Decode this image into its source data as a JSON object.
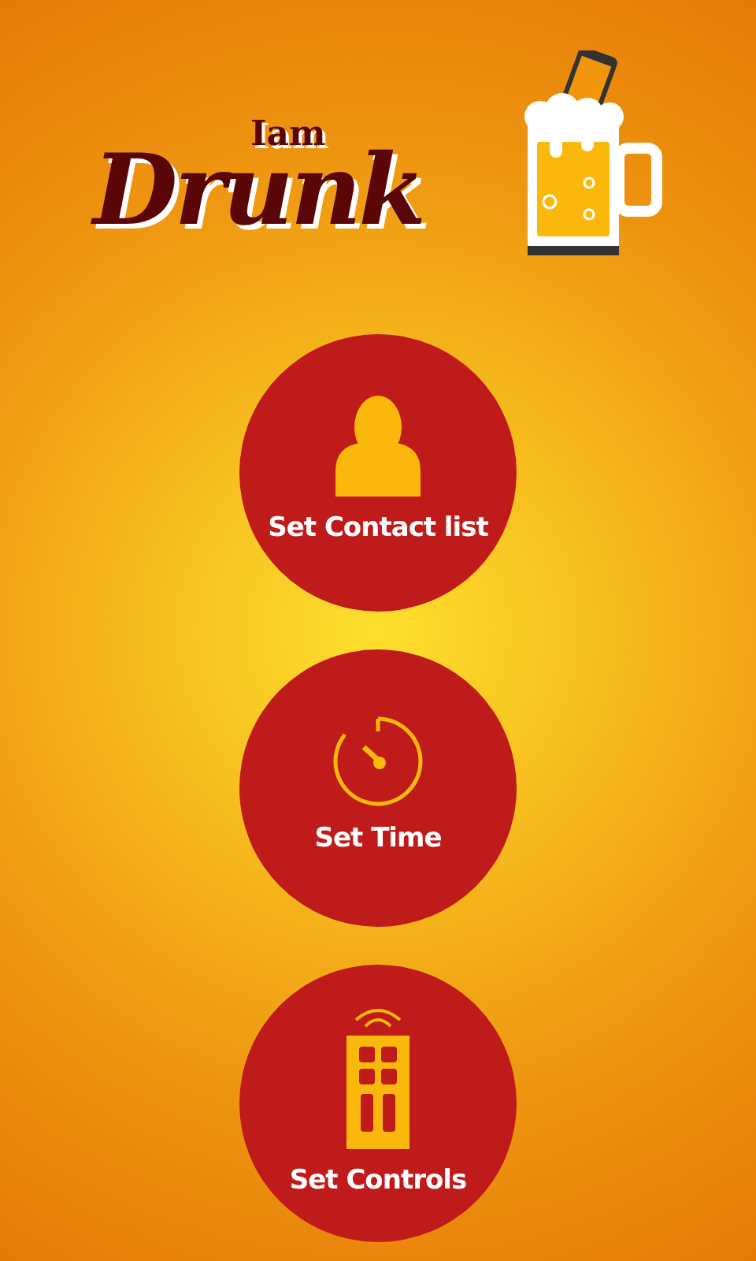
{
  "logo": {
    "small_text": "Iam",
    "big_text": "Drunk"
  },
  "buttons": [
    {
      "kind": "contact",
      "label": "Set Contact list"
    },
    {
      "kind": "time",
      "label": "Set Time"
    },
    {
      "kind": "controls",
      "label": "Set Controls"
    }
  ]
}
